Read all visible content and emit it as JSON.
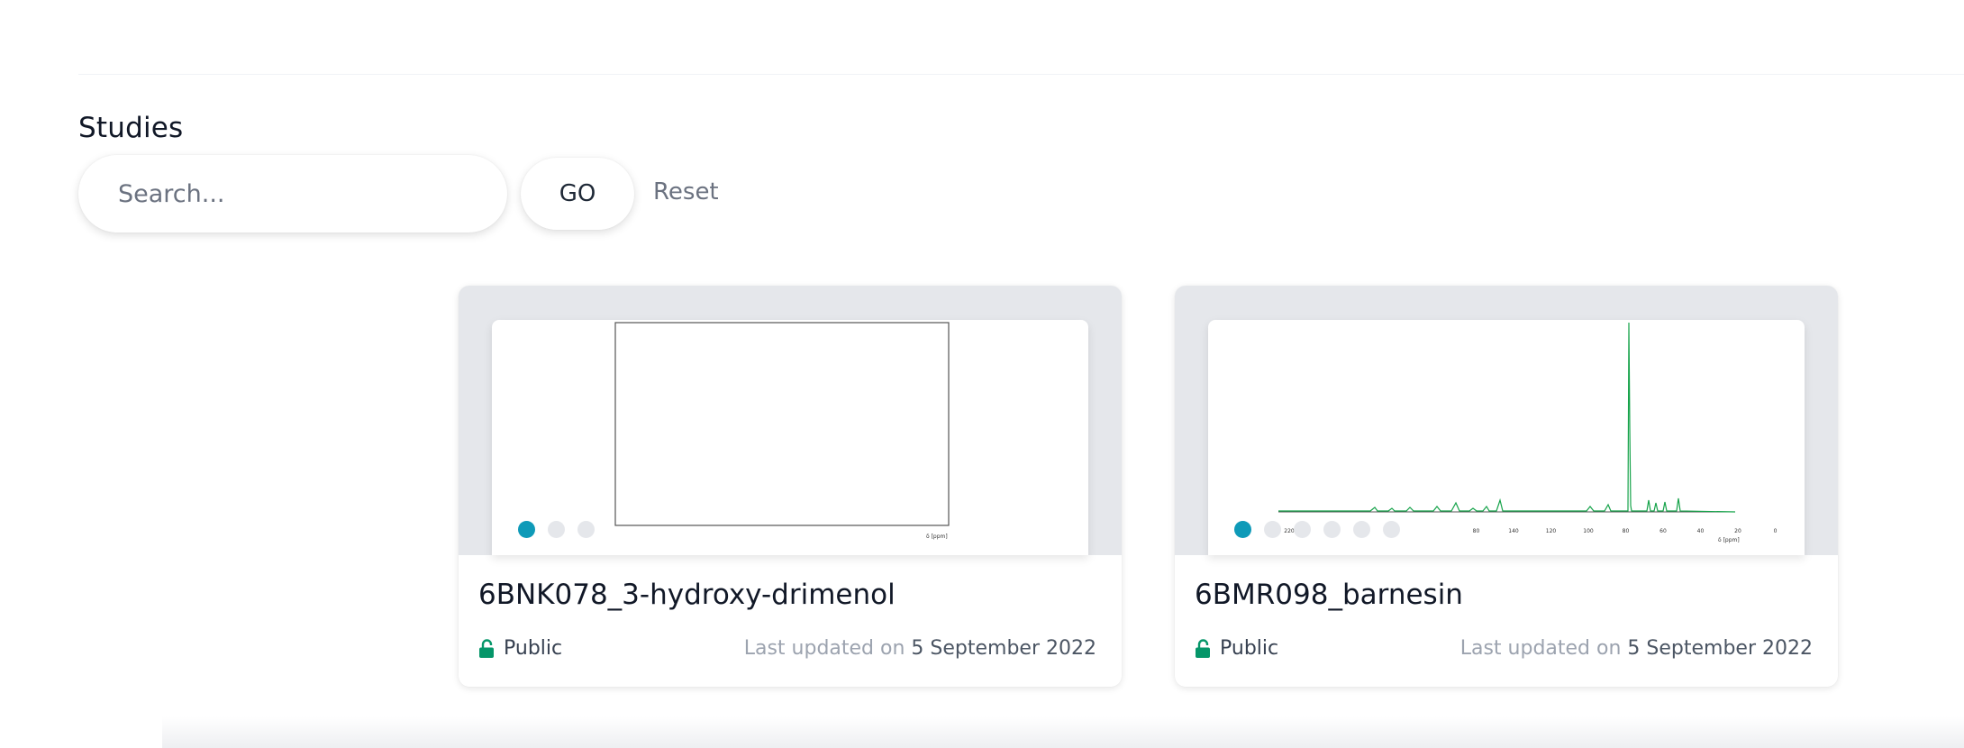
{
  "section": {
    "title": "Studies"
  },
  "search": {
    "placeholder": "Search...",
    "go_label": "GO",
    "reset_label": "Reset"
  },
  "accent_color": "#0e9ab8",
  "public_color": "#059669",
  "cards": [
    {
      "title": "6BNK078_3-hydroxy-drimenol",
      "visibility": "Public",
      "visibility_icon": "unlock-icon",
      "updated_prefix": "Last updated on",
      "updated_date": "5 September 2022",
      "preview_axis_label": "δ [ppm]",
      "carousel_dots": 3,
      "active_dot": 0
    },
    {
      "title": "6BMR098_barnesin",
      "visibility": "Public",
      "visibility_icon": "unlock-icon",
      "updated_prefix": "Last updated on",
      "updated_date": "5 September 2022",
      "preview_axis_label": "δ [ppm]",
      "preview_ticks": [
        "220",
        "2",
        "",
        "",
        "",
        "80",
        "140",
        "120",
        "100",
        "80",
        "60",
        "40",
        "20",
        "0"
      ],
      "carousel_dots": 6,
      "active_dot": 0
    }
  ]
}
